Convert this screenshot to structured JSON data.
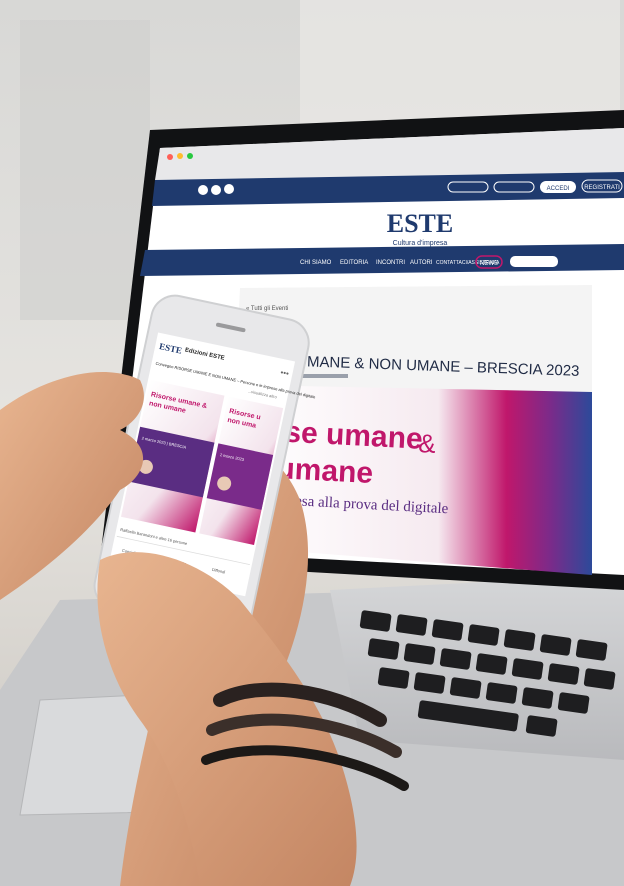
{
  "laptop_screen": {
    "top_bar": {
      "login_button": "ACCEDI",
      "register_button": "REGISTRATI"
    },
    "brand": {
      "logo": "ESTE",
      "tagline": "Cultura d'impresa"
    },
    "nav": {
      "items": [
        "CHI SIAMO",
        "EDITORIA",
        "INCONTRI",
        "AUTORI",
        "CONTATTACI/ASSISTENZA"
      ],
      "news_label": "NEWS"
    },
    "event": {
      "back_link": "« Tutti gli Eventi",
      "title": "UMANE & NON UMANE – BRESCIA 2023"
    },
    "banner": {
      "headline_line1": "orse umane",
      "headline_amp": "&",
      "headline_line2": "umane",
      "subline": "resa alla prova del digitale"
    }
  },
  "phone_screen": {
    "header": {
      "logo": "ESTE",
      "page_name": "Edizioni ESTE",
      "more_icon": "ellipsis-icon"
    },
    "post": {
      "text": "Convegno RISORSE UMANE E NON UMANE – Persone e le imprese alla prova del digitale",
      "see_more": "...visualizza altro"
    },
    "cards": [
      {
        "title_line1": "Risorse umane &",
        "title_line2": "non umane",
        "date_label": "2 marzo 2023 | BRESCIA"
      },
      {
        "title_line1": "Risorse u",
        "title_line2": "non uma",
        "date_label": "2 marzo 2023"
      }
    ],
    "footer": {
      "reactions_label": "Raffaella Barandoni e altre 16 persone",
      "actions": [
        "Consiglia",
        "Commenta",
        "Diffondi"
      ]
    }
  },
  "colors": {
    "brand_navy": "#1f3a6e",
    "banner_magenta": "#c0176b",
    "banner_purple": "#5a2d82",
    "banner_blue": "#2c4a9a"
  }
}
